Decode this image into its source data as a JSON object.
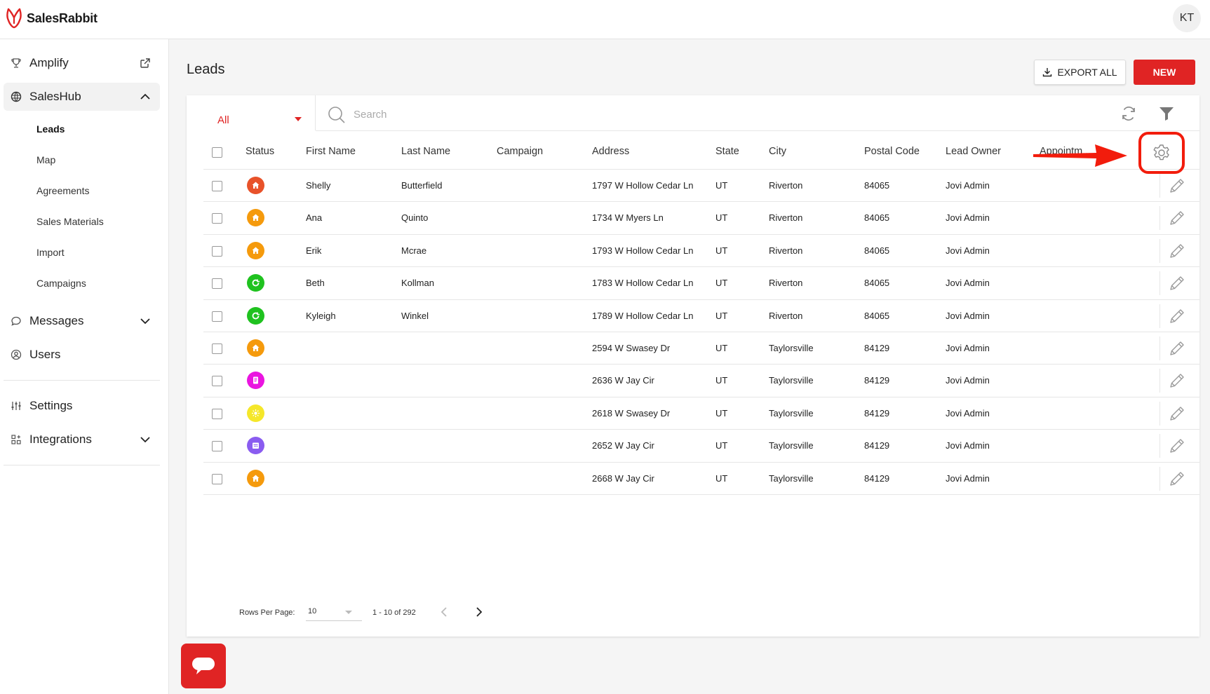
{
  "app": {
    "name": "SalesRabbit",
    "user_initials": "KT"
  },
  "sidebar": {
    "items": [
      {
        "label": "Amplify",
        "icon": "trophy-icon",
        "trail": "external-link-icon"
      },
      {
        "label": "SalesHub",
        "icon": "globe-icon",
        "trail": "chevron-up-icon"
      },
      {
        "label": "Messages",
        "icon": "chat-icon",
        "trail": "chevron-down-icon"
      },
      {
        "label": "Users",
        "icon": "user-circle-icon"
      },
      {
        "label": "Settings",
        "icon": "sliders-icon"
      },
      {
        "label": "Integrations",
        "icon": "apps-icon",
        "trail": "chevron-down-icon"
      }
    ],
    "sub_items": [
      "Leads",
      "Map",
      "Agreements",
      "Sales Materials",
      "Import",
      "Campaigns"
    ]
  },
  "page": {
    "title": "Leads",
    "export_label": "EXPORT ALL",
    "new_label": "NEW"
  },
  "filter": {
    "selected": "All",
    "search_placeholder": "Search"
  },
  "table": {
    "columns": [
      "Status",
      "First Name",
      "Last Name",
      "Campaign",
      "Address",
      "State",
      "City",
      "Postal Code",
      "Lead Owner",
      "Appointm..."
    ],
    "rows": [
      {
        "status_color": "#e8522a",
        "status_icon": "home-icon",
        "first": "Shelly",
        "last": "Butterfield",
        "campaign": "",
        "address": "1797 W Hollow Cedar Ln",
        "state": "UT",
        "city": "Riverton",
        "postal": "84065",
        "owner": "Jovi Admin"
      },
      {
        "status_color": "#f59a0c",
        "status_icon": "home-icon",
        "first": "Ana",
        "last": "Quinto",
        "campaign": "",
        "address": "1734 W Myers Ln",
        "state": "UT",
        "city": "Riverton",
        "postal": "84065",
        "owner": "Jovi Admin"
      },
      {
        "status_color": "#f59a0c",
        "status_icon": "home-icon",
        "first": "Erik",
        "last": "Mcrae",
        "campaign": "",
        "address": "1793 W Hollow Cedar Ln",
        "state": "UT",
        "city": "Riverton",
        "postal": "84065",
        "owner": "Jovi Admin"
      },
      {
        "status_color": "#1fc21f",
        "status_icon": "refresh-icon",
        "first": "Beth",
        "last": "Kollman",
        "campaign": "",
        "address": "1783 W Hollow Cedar Ln",
        "state": "UT",
        "city": "Riverton",
        "postal": "84065",
        "owner": "Jovi Admin"
      },
      {
        "status_color": "#1fc21f",
        "status_icon": "refresh-icon",
        "first": "Kyleigh",
        "last": "Winkel",
        "campaign": "",
        "address": "1789 W Hollow Cedar Ln",
        "state": "UT",
        "city": "Riverton",
        "postal": "84065",
        "owner": "Jovi Admin"
      },
      {
        "status_color": "#f59a0c",
        "status_icon": "home-icon",
        "first": "",
        "last": "",
        "campaign": "",
        "address": "2594 W Swasey Dr",
        "state": "UT",
        "city": "Taylorsville",
        "postal": "84129",
        "owner": "Jovi Admin"
      },
      {
        "status_color": "#ea14e0",
        "status_icon": "document-icon",
        "first": "",
        "last": "",
        "campaign": "",
        "address": "2636 W Jay Cir",
        "state": "UT",
        "city": "Taylorsville",
        "postal": "84129",
        "owner": "Jovi Admin"
      },
      {
        "status_color": "#f5e72a",
        "status_icon": "sun-icon",
        "first": "",
        "last": "",
        "campaign": "",
        "address": "2618 W Swasey Dr",
        "state": "UT",
        "city": "Taylorsville",
        "postal": "84129",
        "owner": "Jovi Admin"
      },
      {
        "status_color": "#8a5cf0",
        "status_icon": "calendar-icon",
        "first": "",
        "last": "",
        "campaign": "",
        "address": "2652 W Jay Cir",
        "state": "UT",
        "city": "Taylorsville",
        "postal": "84129",
        "owner": "Jovi Admin"
      },
      {
        "status_color": "#f59a0c",
        "status_icon": "home-icon",
        "first": "",
        "last": "",
        "campaign": "",
        "address": "2668 W Jay Cir",
        "state": "UT",
        "city": "Taylorsville",
        "postal": "84129",
        "owner": "Jovi Admin"
      }
    ]
  },
  "pagination": {
    "rows_per_page_label": "Rows Per Page:",
    "rows_per_page": "10",
    "range": "1 - 10 of 292"
  },
  "colors": {
    "accent": "#e02424",
    "highlight": "#f21c0c"
  }
}
